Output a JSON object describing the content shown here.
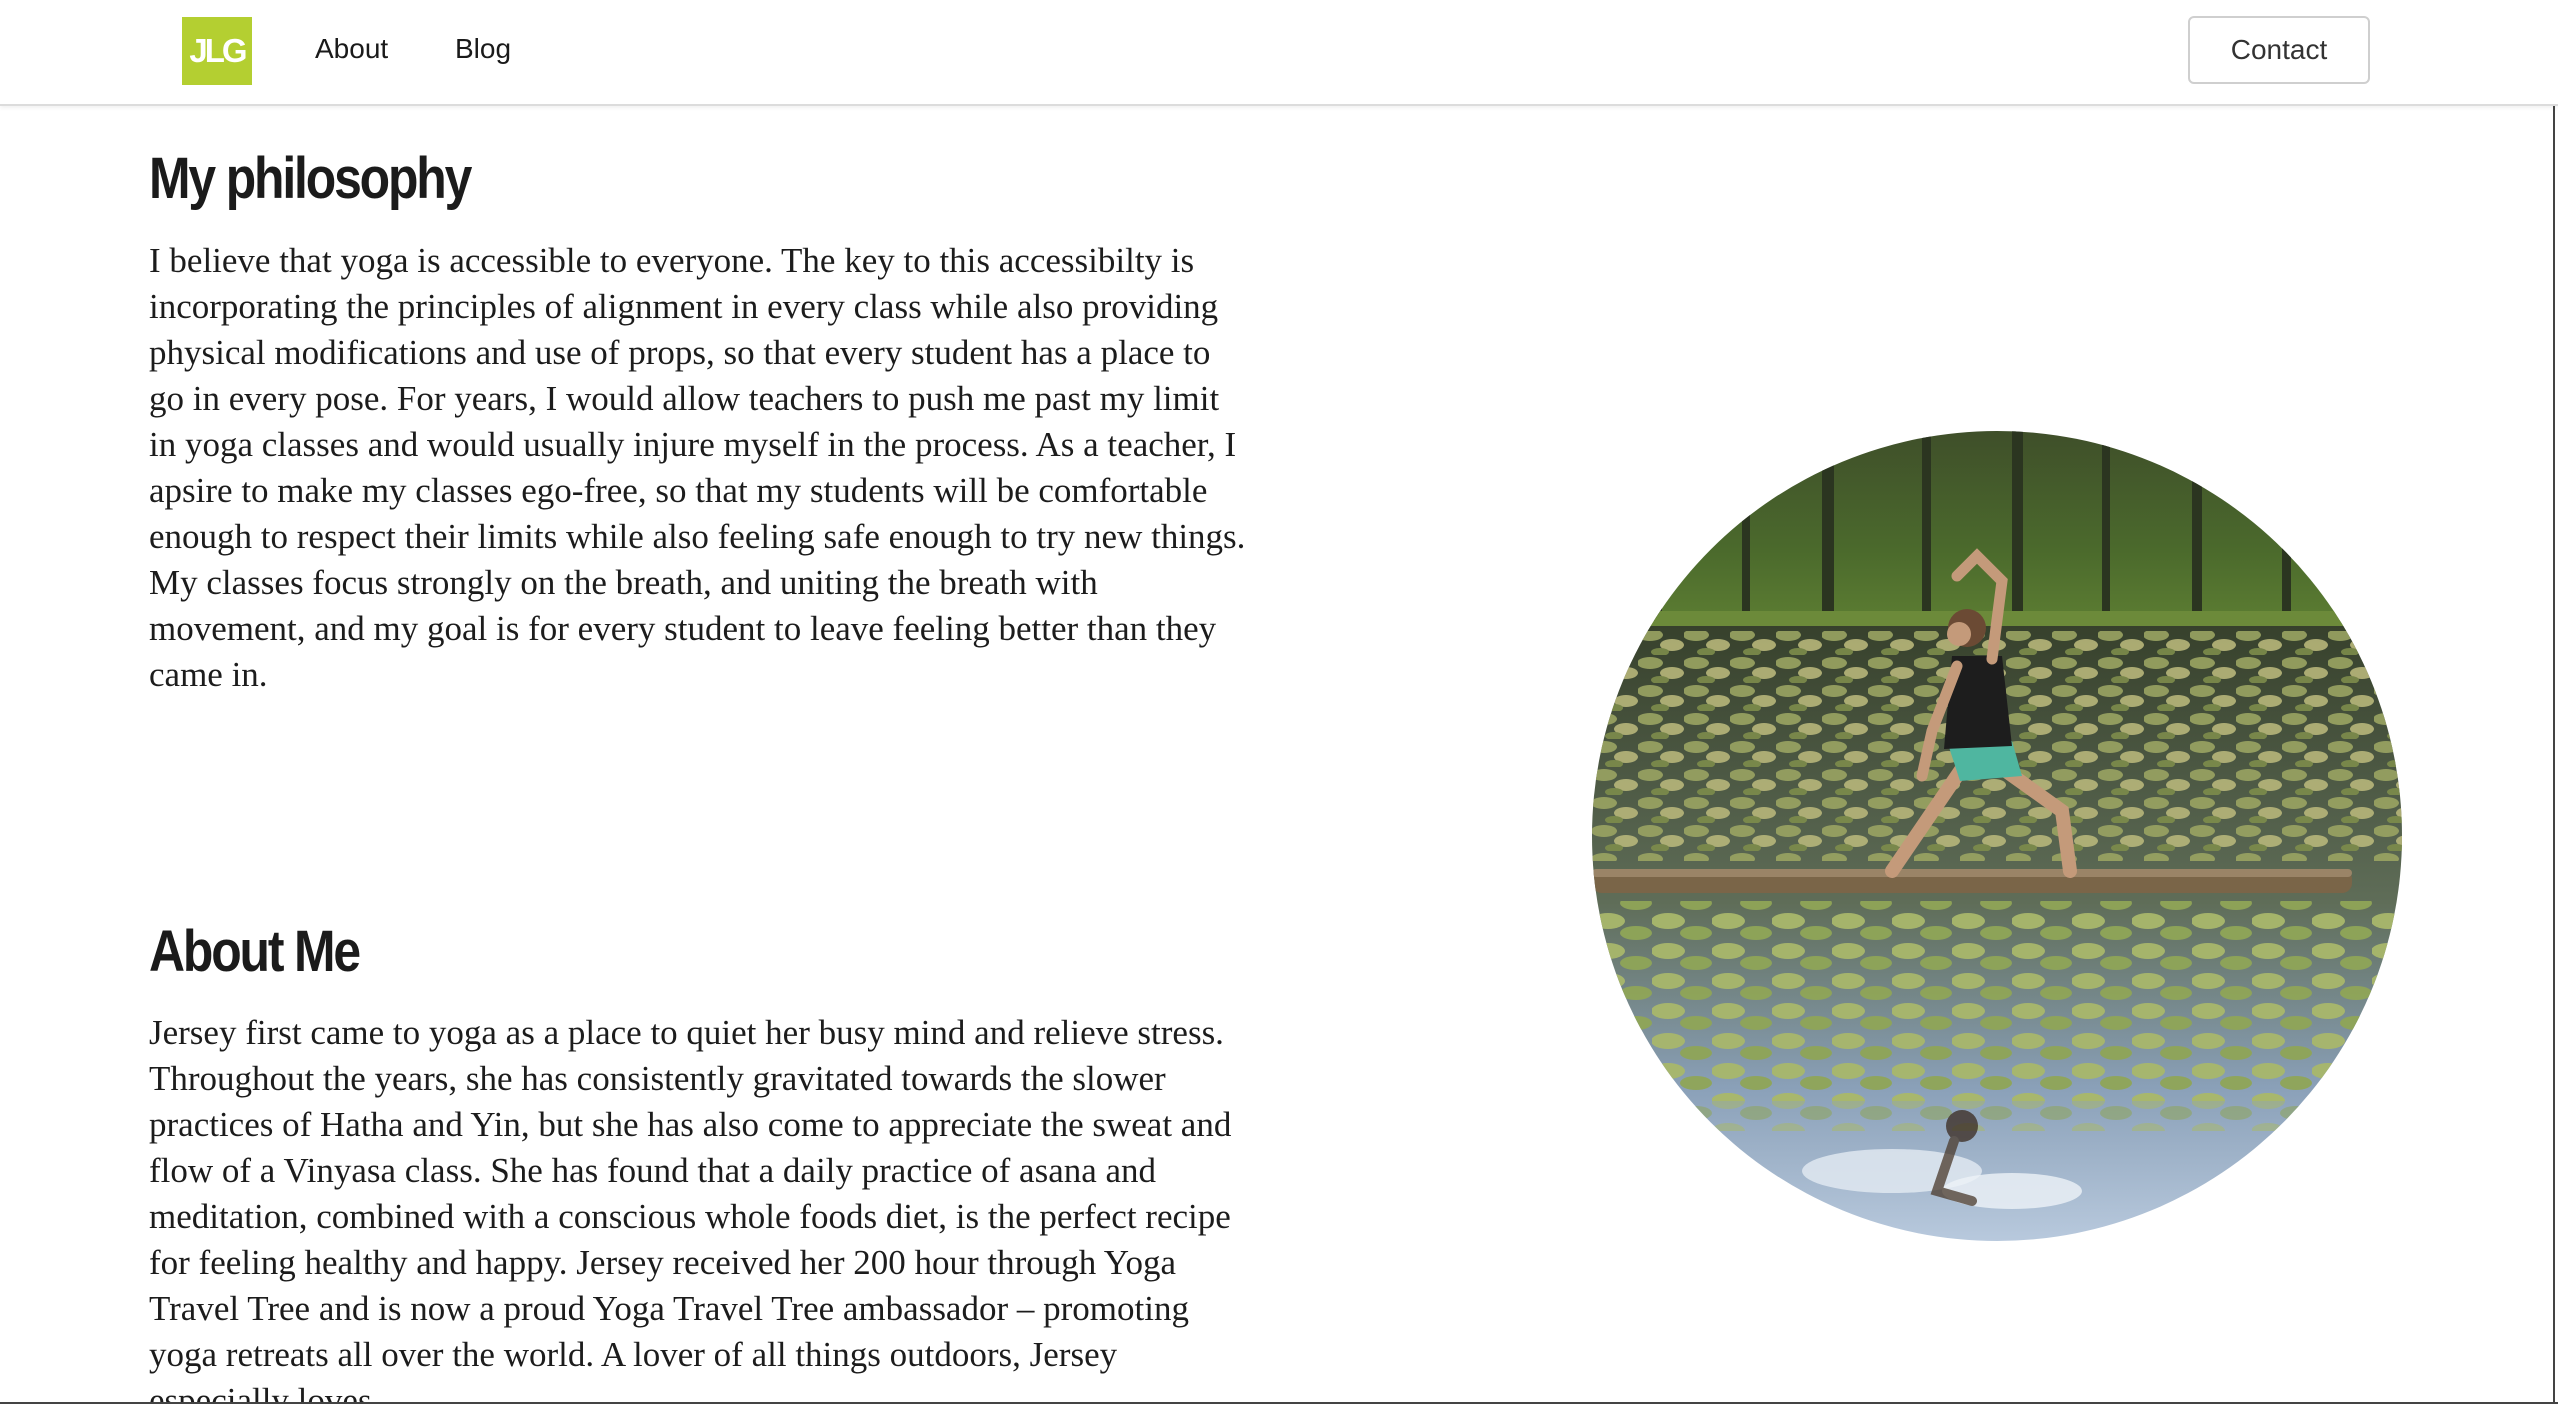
{
  "nav": {
    "logo_text": "JLG",
    "links": [
      {
        "label": "About"
      },
      {
        "label": "Blog"
      }
    ],
    "contact_label": "Contact"
  },
  "sections": {
    "philosophy": {
      "heading": "My philosophy",
      "body": "I believe that yoga is accessible to everyone. The key to this accessibilty is incorporating the principles of alignment in every class while also providing physical modifications and use of props, so that every student has a place to go in every pose. For years, I would allow teachers to push me past my limit in yoga classes and would usually injure myself in the process. As a teacher, I apsire to make my classes ego-free, so that my students will be comfortable enough to respect their limits while also feeling safe enough to try new things. My classes focus strongly on the breath, and uniting the breath with movement, and my goal is for every student to leave feeling better than they came in."
    },
    "about": {
      "heading": "About Me",
      "body": "Jersey first came to yoga as a place to quiet her busy mind and relieve stress. Throughout the years, she has consistently gravitated towards the slower practices of Hatha and Yin, but she has also come to appreciate the sweat and flow of a Vinyasa class. She has found that a daily practice of asana and meditation, combined with a conscious whole foods diet, is the perfect recipe for feeling healthy and happy. Jersey received her 200 hour through Yoga Travel Tree and is now a proud Yoga Travel Tree ambassador – promoting yoga retreats all over the world. A lover of all things outdoors, Jersey especially loves"
    }
  },
  "photo": {
    "icon": "yoga-pose-on-lily-pond-photo"
  },
  "colors": {
    "brand": "#b4cf31",
    "text": "#1c1c1c",
    "contact_border": "#cfcfcf"
  }
}
